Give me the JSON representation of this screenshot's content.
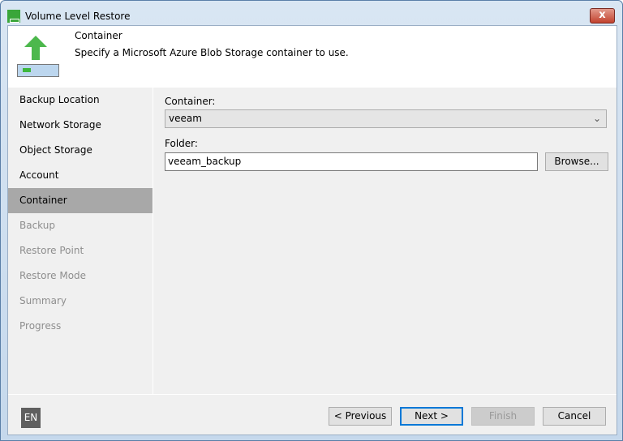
{
  "window": {
    "title": "Volume Level Restore",
    "close_label": "x"
  },
  "header": {
    "title": "Container",
    "description": "Specify a Microsoft Azure Blob Storage container to use."
  },
  "sidebar": {
    "items": [
      {
        "label": "Backup Location"
      },
      {
        "label": "Network Storage"
      },
      {
        "label": "Object Storage"
      },
      {
        "label": "Account"
      },
      {
        "label": "Container"
      },
      {
        "label": "Backup"
      },
      {
        "label": "Restore Point"
      },
      {
        "label": "Restore Mode"
      },
      {
        "label": "Summary"
      },
      {
        "label": "Progress"
      }
    ]
  },
  "form": {
    "container_label": "Container:",
    "container_value": "veeam",
    "folder_label": "Folder:",
    "folder_value": "veeam_backup",
    "browse_label": "Browse..."
  },
  "footer": {
    "language": "EN",
    "previous": "< Previous",
    "next": "Next >",
    "finish": "Finish",
    "cancel": "Cancel"
  }
}
